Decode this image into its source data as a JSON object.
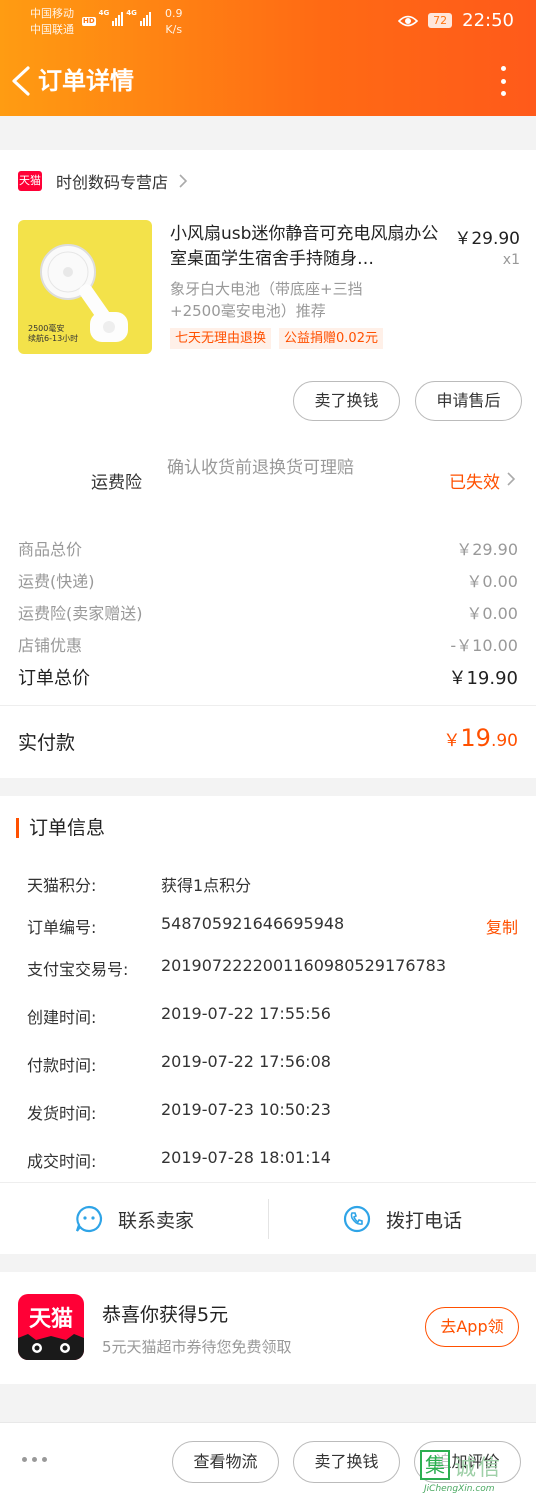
{
  "status_bar": {
    "carrier1": "中国移动",
    "carrier2": "中国联通",
    "hd": "HD",
    "net1": "4G",
    "net2": "4G",
    "speed_value": "0.9",
    "speed_unit": "K/s",
    "battery": "72",
    "time": "22:50"
  },
  "nav": {
    "title": "订单详情",
    "icons": [
      "back-arrow-icon",
      "more-vertical-icon"
    ]
  },
  "shop": {
    "badge": "天猫",
    "name": "时创数码专营店"
  },
  "product": {
    "title": "小风扇usb迷你静音可充电风扇办公室桌面学生宿舍手持随身…",
    "price": "￥29.90",
    "quantity": "x1",
    "sku": "象牙白大电池（带底座+三挡+2500毫安电池）推荐",
    "image_text_1": "2500毫安",
    "image_text_2": "续航6-13小时",
    "tags": [
      "七天无理由退换",
      "公益捐赠0.02元"
    ],
    "actions": [
      "卖了换钱",
      "申请售后"
    ]
  },
  "insurance": {
    "label": "运费险",
    "desc": "确认收货前退换货可理赔",
    "status": "已失效"
  },
  "prices": [
    {
      "label": "商品总价",
      "value": "￥29.90"
    },
    {
      "label": "运费(快递)",
      "value": "￥0.00"
    },
    {
      "label": "运费险(卖家赠送)",
      "value": "￥0.00"
    },
    {
      "label": "店铺优惠",
      "value": "-￥10.00"
    }
  ],
  "order_total": {
    "label": "订单总价",
    "value": "￥19.90"
  },
  "paid": {
    "label": "实付款",
    "currency": "￥",
    "integer": "19",
    "decimal": ".90"
  },
  "order_info": {
    "title": "订单信息",
    "rows": [
      {
        "key": "天猫积分:",
        "value": "获得1点积分"
      },
      {
        "key": "订单编号:",
        "value": "548705921646695948",
        "action": "复制"
      },
      {
        "key": "支付宝交易号:",
        "value": "2019072222001160980529176783"
      },
      {
        "key": "创建时间:",
        "value": "2019-07-22 17:55:56"
      },
      {
        "key": "付款时间:",
        "value": "2019-07-22 17:56:08"
      },
      {
        "key": "发货时间:",
        "value": "2019-07-23 10:50:23"
      },
      {
        "key": "成交时间:",
        "value": "2019-07-28 18:01:14"
      }
    ],
    "contact_seller": "联系卖家",
    "call_phone": "拨打电话"
  },
  "promo": {
    "logo_text": "天猫",
    "title": "恭喜你获得5元",
    "subtitle": "5元天猫超市券待您免费领取",
    "button": "去App领"
  },
  "bottom_bar": {
    "logistics": "查看物流",
    "sell": "卖了换钱",
    "review": "追加评价"
  },
  "watermark": {
    "mark": "集",
    "cn": "诚信",
    "en": "JiChengXin.com"
  },
  "colors": {
    "accent": "#ff5000",
    "header_start": "#ff9c12",
    "header_end": "#ff5a1a",
    "tmall_red": "#ff0036"
  }
}
